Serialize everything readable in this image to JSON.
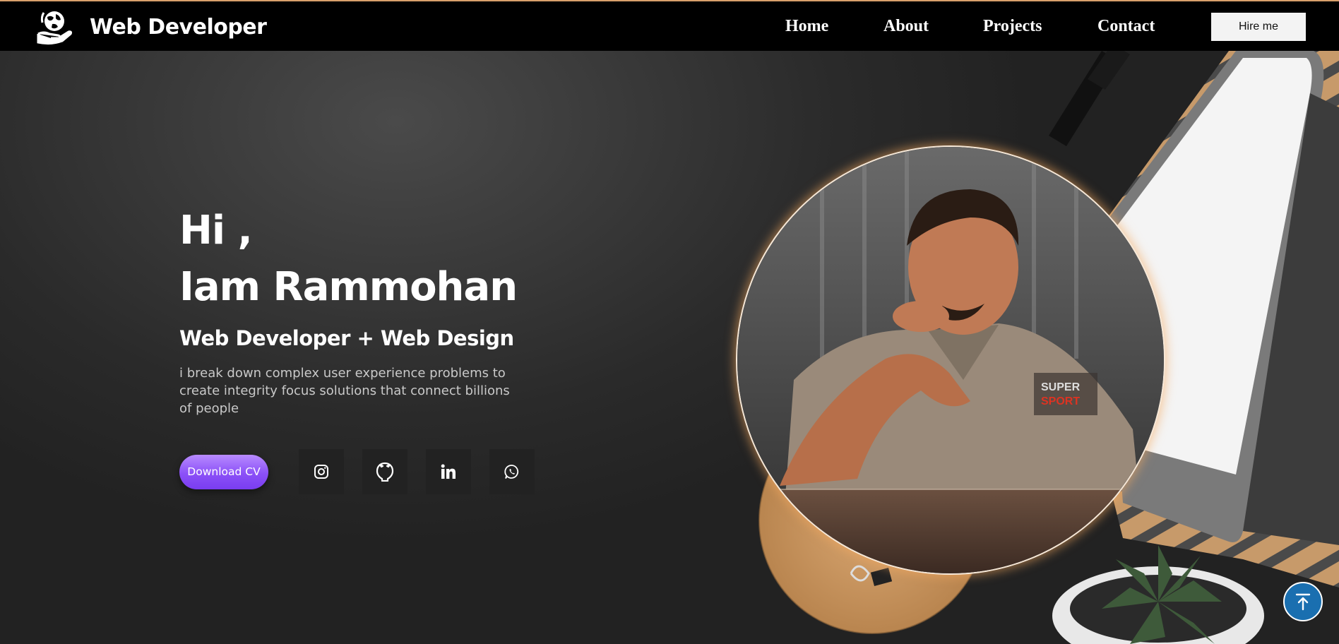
{
  "header": {
    "brand": "Web Developer",
    "logo_icon": "globe-in-hand-icon",
    "nav": [
      {
        "label": "Home"
      },
      {
        "label": "About"
      },
      {
        "label": "Projects"
      },
      {
        "label": "Contact"
      }
    ],
    "hire_label": "Hire me"
  },
  "hero": {
    "greeting": "Hi ,",
    "name": "Iam Rammohan",
    "role": "Web Developer + Web Design",
    "description": "i break down complex user experience problems to create integrity focus solutions that connect billions of people",
    "download_label": "Download CV",
    "socials": [
      {
        "icon": "instagram-icon"
      },
      {
        "icon": "github-icon"
      },
      {
        "icon": "linkedin-icon"
      },
      {
        "icon": "whatsapp-icon"
      }
    ]
  },
  "scroll_top_icon": "arrow-up-to-top-icon",
  "colors": {
    "navbar": "#000000",
    "accent_purple": "#8b50f7",
    "scroll_top": "#1a6fb0",
    "portrait_glow": "#f5aa5f"
  }
}
